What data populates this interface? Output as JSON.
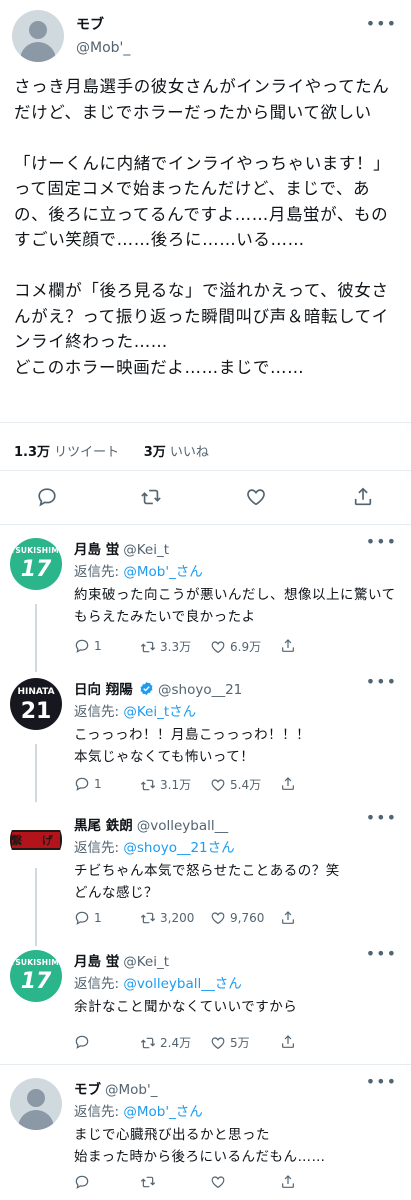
{
  "main": {
    "name": "モブ",
    "handle": "@Mob'_",
    "text": "さっき月島選手の彼女さんがインライやってたんだけど、まじでホラーだったから聞いて欲しい\n\n「けーくんに内緒でインライやっちゃいます！」って固定コメで始まったんだけど、まじで、あの、後ろに立ってるんですよ……月島蛍が、ものすごい笑顔で……後ろに……いる……\n\nコメ欄が「後ろ見るな」で溢れかえって、彼女さんがえ？って振り返った瞬間叫び声＆暗転してインライ終わった……\nどこのホラー映画だよ……まじで……",
    "retweets_count": "1.3万",
    "retweets_label": "リツイート",
    "likes_count": "3万",
    "likes_label": "いいね"
  },
  "reply_to_label": "返信先:",
  "more_label": "•••",
  "replies": [
    {
      "name": "月島 蛍",
      "handle": "@Kei_t",
      "avatar_top": "TSUKISHIMA",
      "avatar_num": "17",
      "reply_to": "@Mob'_さん",
      "text": "約束破った向こうが悪いんだし、想像以上に驚いてもらえたみたいで良かったよ",
      "replies": "1",
      "retweets": "3.3万",
      "likes": "6.9万"
    },
    {
      "name": "日向 翔陽",
      "handle": "@shoyo__21",
      "avatar_top": "HINATA",
      "avatar_num": "21",
      "reply_to": "@Kei_tさん",
      "text": "こっっっわ！！月島こっっっわ！！！\n本気じゃなくても怖いって！",
      "replies": "1",
      "retweets": "3.1万",
      "likes": "5.4万"
    },
    {
      "name": "黒尾 鉄朗",
      "handle": "@volleyball__",
      "avatar_top": "繋 げ",
      "reply_to": "@shoyo__21さん",
      "text": "チビちゃん本気で怒らせたことあるの？笑\nどんな感じ？",
      "replies": "1",
      "retweets": "3,200",
      "likes": "9,760"
    },
    {
      "name": "月島 蛍",
      "handle": "@Kei_t",
      "avatar_top": "TSUKISHIMA",
      "avatar_num": "17",
      "reply_to": "@volleyball__さん",
      "text": "余計なこと聞かなくていいですから",
      "replies": "",
      "retweets": "2.4万",
      "likes": "5万"
    },
    {
      "name": "モブ",
      "handle": "@Mob'_",
      "reply_to": "@Mob'_さん",
      "text": "まじで心臓飛び出るかと思った\n始まった時から後ろにいるんだもん……",
      "replies": "",
      "retweets": "",
      "likes": ""
    }
  ],
  "colors": {
    "accent": "#1d9bf0",
    "text": "#0f1419",
    "muted": "#536471",
    "divider": "#e6ecf0",
    "tsukishima_green": "#2bb58a",
    "nekoma_red": "#b3131b"
  },
  "icons": [
    "reply-icon",
    "retweet-icon",
    "like-icon",
    "share-icon",
    "verified-icon",
    "more-icon"
  ]
}
